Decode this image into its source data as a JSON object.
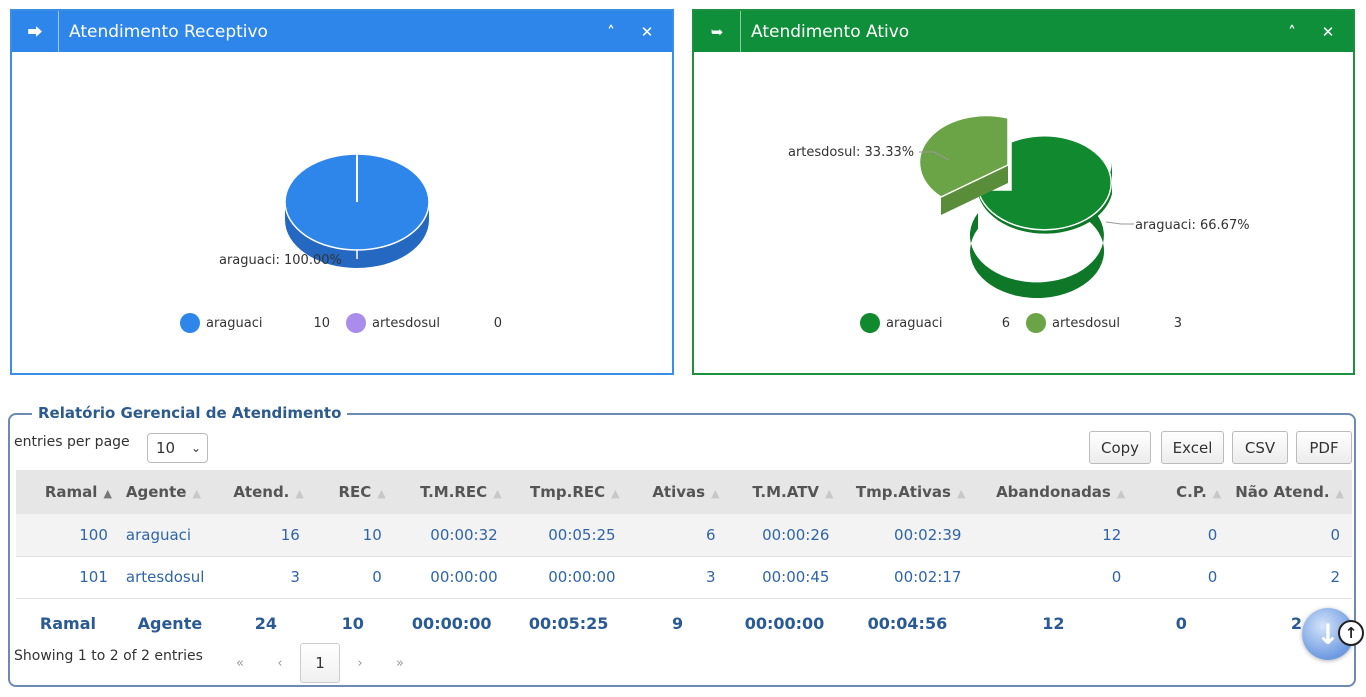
{
  "panels": {
    "receptivo": {
      "title": "Atendimento Receptivo",
      "color": "#2e86ea",
      "pie_label": "araguaci: 100.00%",
      "legend": [
        {
          "name": "araguaci",
          "value": "10",
          "color": "#2f86ea"
        },
        {
          "name": "artesdosul",
          "value": "0",
          "color": "#a98ceb"
        }
      ]
    },
    "ativo": {
      "title": "Atendimento Ativo",
      "color": "#0f8f39",
      "label_left": "artesdosul: 33.33%",
      "label_right": "araguaci: 66.67%",
      "legend": [
        {
          "name": "araguaci",
          "value": "6",
          "color": "#11892f"
        },
        {
          "name": "artesdosul",
          "value": "3",
          "color": "#6aa446"
        }
      ]
    }
  },
  "chart_data": [
    {
      "type": "pie",
      "categories": [
        "araguaci",
        "artesdosul"
      ],
      "values": [
        10,
        0
      ],
      "title": "Atendimento Receptivo"
    },
    {
      "type": "pie",
      "categories": [
        "araguaci",
        "artesdosul"
      ],
      "values": [
        6,
        3
      ],
      "title": "Atendimento Ativo"
    }
  ],
  "report": {
    "title": "Relatório Gerencial de Atendimento",
    "per_page_label": "entries per page",
    "per_page_value": "10",
    "buttons": {
      "copy": "Copy",
      "excel": "Excel",
      "csv": "CSV",
      "pdf": "PDF"
    },
    "columns": [
      "Ramal",
      "Agente",
      "Atend.",
      "REC",
      "T.M.REC",
      "Tmp.REC",
      "Ativas",
      "T.M.ATV",
      "Tmp.Ativas",
      "Abandonadas",
      "C.P.",
      "Não Atend."
    ],
    "rows": [
      [
        "100",
        "araguaci",
        "16",
        "10",
        "00:00:32",
        "00:05:25",
        "6",
        "00:00:26",
        "00:02:39",
        "12",
        "0",
        "0"
      ],
      [
        "101",
        "artesdosul",
        "3",
        "0",
        "00:00:00",
        "00:00:00",
        "3",
        "00:00:45",
        "00:02:17",
        "0",
        "0",
        "2"
      ]
    ],
    "footer": [
      "Ramal",
      "Agente",
      "24",
      "10",
      "00:00:00",
      "00:05:25",
      "9",
      "00:00:00",
      "00:04:56",
      "12",
      "0",
      "2"
    ],
    "showing": "Showing 1 to 2 of 2 entries",
    "pager": {
      "first": "«",
      "prev": "‹",
      "current": "1",
      "next": "›",
      "last": "»"
    }
  }
}
